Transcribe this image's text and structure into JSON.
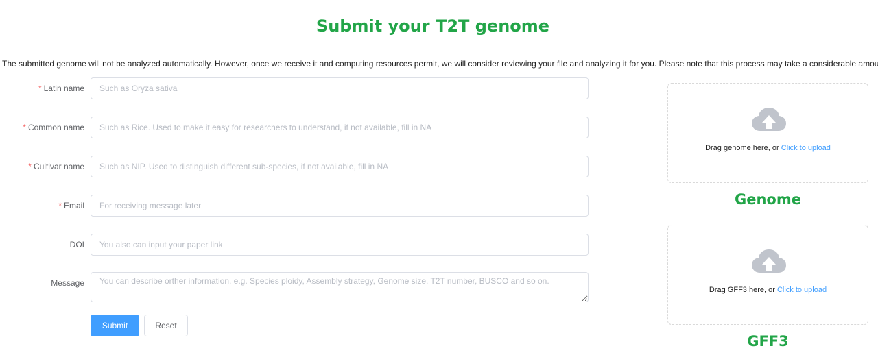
{
  "header": {
    "title": "Submit your T2T genome",
    "notice": "The submitted genome will not be analyzed automatically. However, once we receive it and computing resources permit, we will consider reviewing your file and analyzing it for you. Please note that this process may take a considerable amount of time."
  },
  "form": {
    "required_mark": "*",
    "latin_name": {
      "label": "Latin name",
      "placeholder": "Such as Oryza sativa"
    },
    "common_name": {
      "label": "Common name",
      "placeholder": "Such as Rice. Used to make it easy for researchers to understand, if not available, fill in NA"
    },
    "cultivar_name": {
      "label": "Cultivar name",
      "placeholder": "Such as NIP. Used to distinguish different sub-species, if not available, fill in NA"
    },
    "email": {
      "label": "Email",
      "placeholder": "For receiving message later"
    },
    "doi": {
      "label": "DOI",
      "placeholder": "You also can input your paper link"
    },
    "message": {
      "label": "Message",
      "placeholder": "You can describe orther information, e.g. Species ploidy, Assembly strategy, Genome size, T2T number, BUSCO and so on."
    },
    "submit_label": "Submit",
    "reset_label": "Reset"
  },
  "uploads": {
    "genome": {
      "drag_text": "Drag genome here, or",
      "link_text": "Click to upload",
      "caption": "Genome"
    },
    "gff3": {
      "drag_text": "Drag GFF3 here, or",
      "link_text": "Click to upload",
      "caption": "GFF3"
    }
  },
  "colors": {
    "title_green": "#22a548",
    "primary_blue": "#409eff",
    "required_red": "#f56c6c",
    "upload_icon_gray": "#c0c4cc"
  },
  "icons": {
    "upload": "upload-cloud-icon"
  }
}
